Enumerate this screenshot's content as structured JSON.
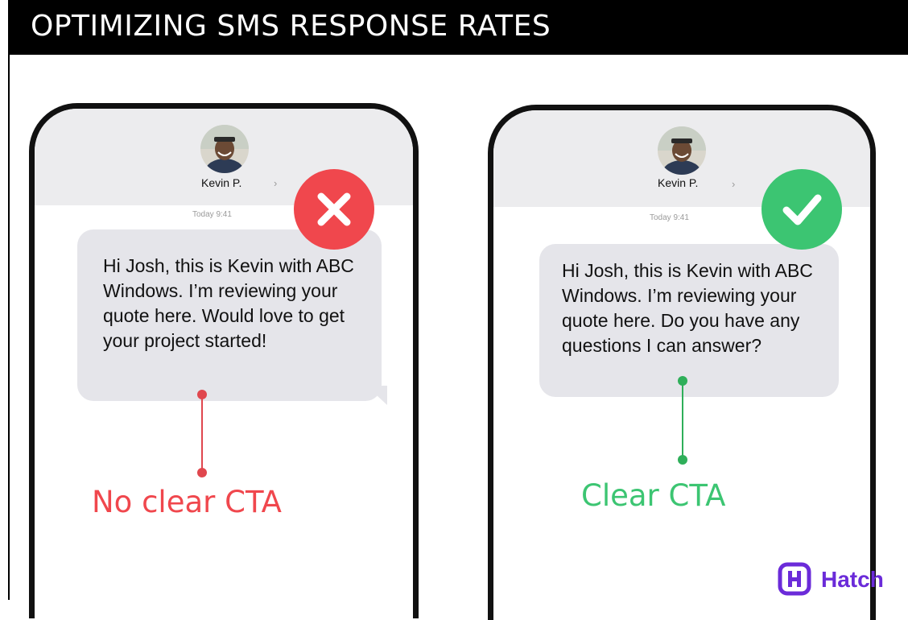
{
  "header": {
    "title": "OPTIMIZING SMS RESPONSE RATES"
  },
  "examples": {
    "bad": {
      "contact_name": "Kevin P.",
      "timestamp": "Today 9:41",
      "message": "Hi Josh, this is Kevin with ABC Windows. I’m reviewing your quote here. Would love to get your project started!",
      "cta_label": "No clear CTA",
      "status_icon": "x-icon",
      "accent_color": "#f0474d"
    },
    "good": {
      "contact_name": "Kevin P.",
      "timestamp": "Today 9:41",
      "message": "Hi Josh, this is Kevin with ABC Windows. I’m reviewing your quote here. Do you have any questions I can answer?",
      "cta_label": "Clear CTA",
      "status_icon": "check-icon",
      "accent_color": "#3cc572"
    }
  },
  "brand": {
    "logo_text": "Hatch",
    "color": "#6b2bd9"
  },
  "colors": {
    "bubble": "#e5e5ea",
    "header": "#ececee",
    "cta_line_bad": "#e0474e",
    "cta_line_good": "#2faf5a"
  }
}
